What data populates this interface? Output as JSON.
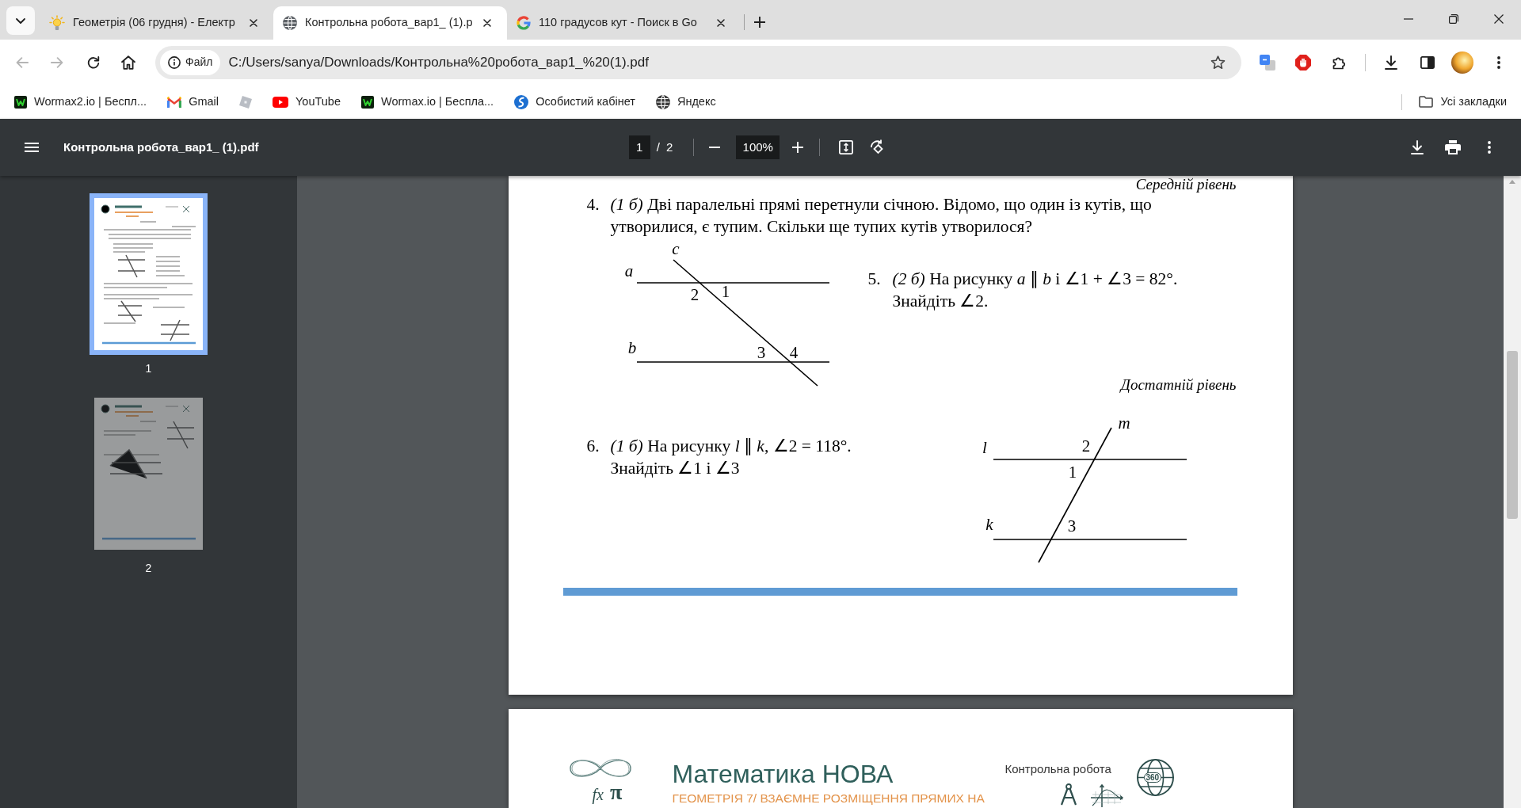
{
  "tab_strip": {
    "tabs": [
      {
        "title": "Геометрія (06 грудня) - Електр",
        "selected": false
      },
      {
        "title": "Контрольна робота_вар1_ (1).p",
        "selected": true
      },
      {
        "title": "110 градусов кут - Поиск в Go",
        "selected": false
      }
    ]
  },
  "toolbar": {
    "back": {
      "disabled": true
    },
    "forward": {
      "disabled": true
    },
    "site_chip": "Файл",
    "url": "C:/Users/sanya/Downloads/Контрольна%20робота_вар1_%20(1).pdf"
  },
  "bookmarks_bar": {
    "bookmarks": [
      {
        "kind": "link",
        "label": "Wormax2.io | Беспл..."
      },
      {
        "kind": "link",
        "label": "Gmail"
      },
      {
        "kind": "icon"
      },
      {
        "kind": "link",
        "label": "YouTube"
      },
      {
        "kind": "link",
        "label": "Wormax.io | Беспла..."
      },
      {
        "kind": "link",
        "label": "Особистий кабінет"
      },
      {
        "kind": "link",
        "label": "Яндекс"
      }
    ],
    "all_bookmarks": "Усі закладки"
  },
  "pdf_toolbar": {
    "title": "Контрольна робота_вар1_ (1).pdf",
    "page_input": "1",
    "page_separator": "/",
    "page_count": "2",
    "zoom": "100%"
  },
  "sidebar": {
    "thumbnails": [
      {
        "label": "1",
        "selected": true
      },
      {
        "label": "2",
        "selected": false
      }
    ]
  },
  "page_1": {
    "level_heading": "Середній рівень",
    "task_4": {
      "number": "4.",
      "text": "*(1 б)* Дві паралельні прямі перетнули січною. Відомо, що один із кутів, що утворилися, є тупим. Скільки ще тупих кутів утворилося?",
      "figure": {
        "line_labels": [
          "c",
          "a",
          "b"
        ],
        "angle_labels": [
          "2",
          "1",
          "3",
          "4"
        ]
      }
    },
    "task_5": {
      "number": "5.",
      "text": "*(2 б)* На рисунку *a* ∥ *b* і ∠1 + ∠3 = 82°. Знайдіть ∠2."
    },
    "level_heading_2": "Достатній рівень",
    "task_6": {
      "number": "6.",
      "text": "*(1 б)* На рисунку *l* ∥ *k*, ∠2 = 118°. Знайдіть ∠1 і ∠3",
      "figure": {
        "line_labels": [
          "m",
          "l",
          "k"
        ],
        "angle_labels": [
          "2",
          "1",
          "3"
        ]
      }
    }
  },
  "page_2": {
    "logo_symbols": [
      "fx",
      "π"
    ],
    "title": "Математика НОВА",
    "subtitle": "ГЕОМЕТРІЯ 7/ ВЗАЄМНЕ РОЗМІЩЕННЯ ПРЯМИХ НА",
    "document_type": "Контрольна робота",
    "globe_label": "360"
  }
}
